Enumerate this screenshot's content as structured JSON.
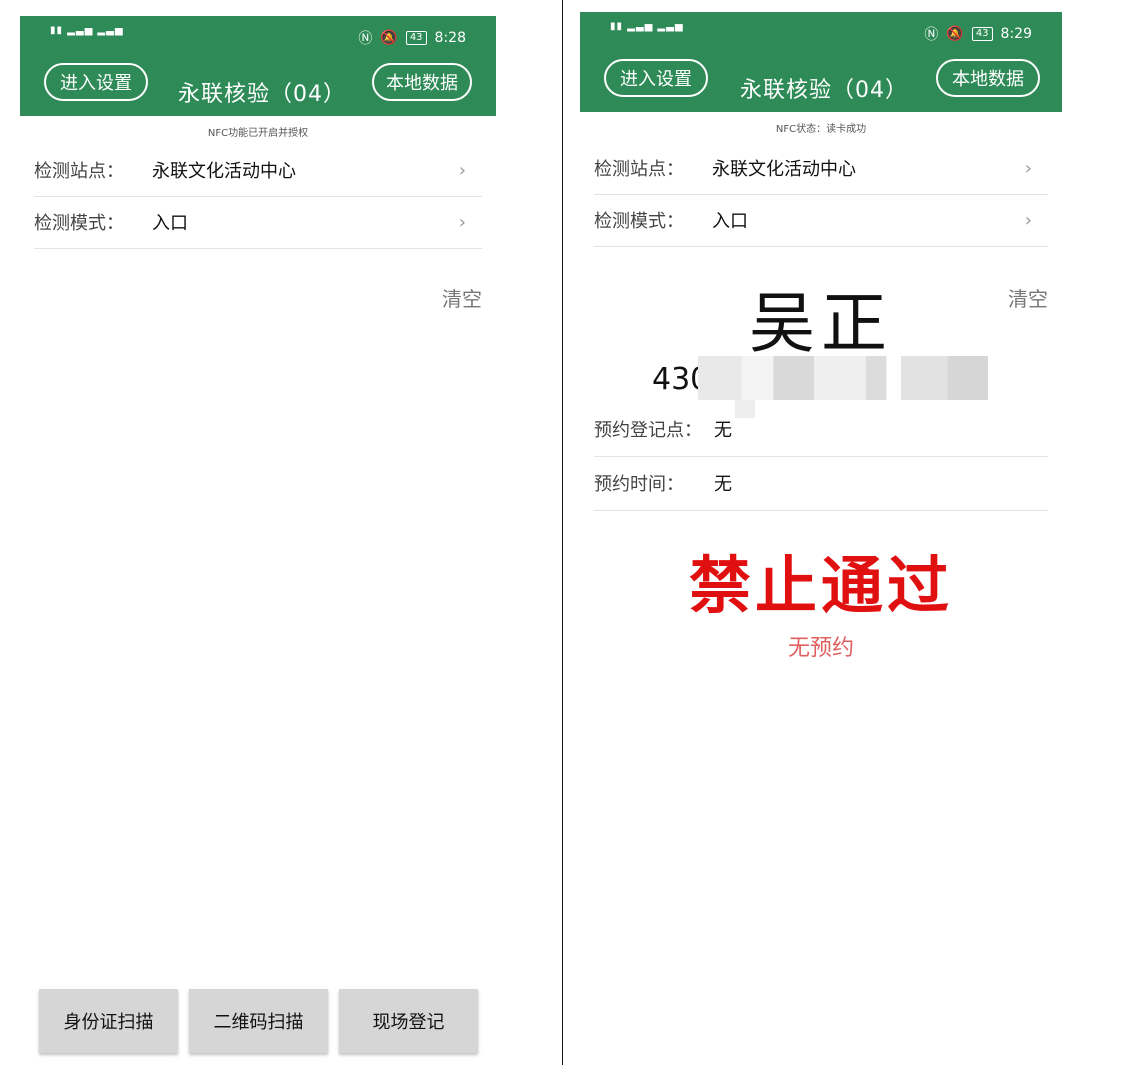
{
  "left": {
    "status": {
      "time": "8:28",
      "battery": "43"
    },
    "header": {
      "settings_label": "进入设置",
      "title": "永联核验（04）",
      "local_label": "本地数据"
    },
    "nfc_status": "NFC功能已开启并授权",
    "fields": [
      {
        "label": "检测站点：",
        "value": "永联文化活动中心"
      },
      {
        "label": "检测模式：",
        "value": "入口"
      }
    ],
    "clear_label": "清空",
    "buttons": [
      "身份证扫描",
      "二维码扫描",
      "现场登记"
    ]
  },
  "right": {
    "status": {
      "time": "8:29",
      "battery": "43"
    },
    "header": {
      "settings_label": "进入设置",
      "title": "永联核验（04）",
      "local_label": "本地数据"
    },
    "nfc_status": "NFC状态：读卡成功",
    "fields": [
      {
        "label": "检测站点：",
        "value": "永联文化活动中心"
      },
      {
        "label": "检测模式：",
        "value": "入口"
      }
    ],
    "clear_label": "清空",
    "person": {
      "name": "吴正",
      "id_prefix": "430"
    },
    "booking": [
      {
        "label": "预约登记点：",
        "value": "无"
      },
      {
        "label": "预约时间：",
        "value": "无"
      }
    ],
    "result": {
      "status": "禁止通过",
      "reason": "无预约"
    }
  },
  "icons": {
    "nfc": "nfc-icon",
    "mute": "bell-off-icon",
    "chevron": "chevron-right-icon"
  },
  "colors": {
    "brand": "#2e8b57",
    "deny": "#e01010",
    "reason": "#e06060"
  }
}
